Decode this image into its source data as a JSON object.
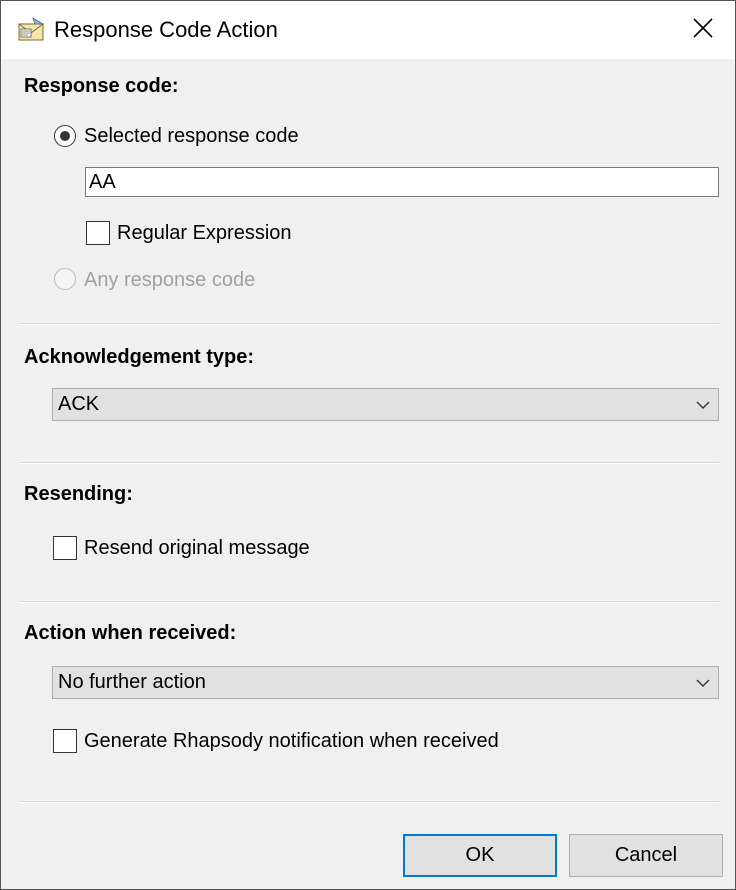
{
  "window": {
    "title": "Response Code Action",
    "icon": "envelope-app-icon"
  },
  "response_code": {
    "heading": "Response code:",
    "selected_option": "Selected response code",
    "selected_checked": true,
    "code_value": "AA",
    "regex_label": "Regular Expression",
    "regex_checked": false,
    "any_option": "Any response code",
    "any_enabled": false
  },
  "acknowledgement": {
    "heading": "Acknowledgement type:",
    "value": "ACK"
  },
  "resending": {
    "heading": "Resending:",
    "resend_label": "Resend original message",
    "resend_checked": false
  },
  "action": {
    "heading": "Action when received:",
    "value": "No further action",
    "notify_label": "Generate Rhapsody notification when received",
    "notify_checked": false
  },
  "buttons": {
    "ok": "OK",
    "cancel": "Cancel"
  },
  "colors": {
    "accent": "#0078d7",
    "background": "#f0f0f0"
  }
}
